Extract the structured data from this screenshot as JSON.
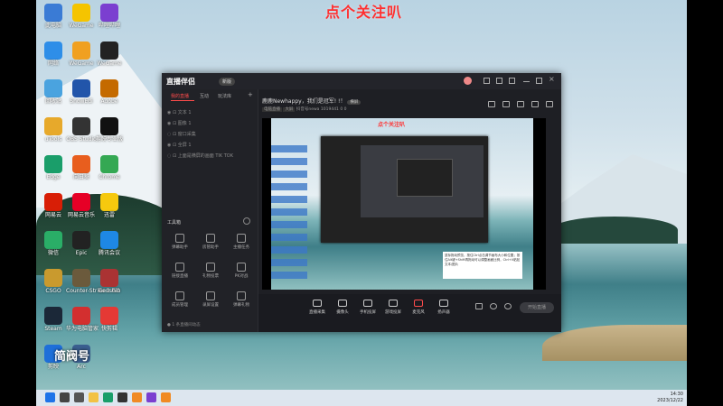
{
  "overlay_title": "点个关注叭",
  "watermark": "简阀号",
  "desktop_icons": [
    {
      "label": "此电脑",
      "color": "#3a7bd5",
      "col": 0,
      "row": 0
    },
    {
      "label": "WeGame",
      "color": "#f5c400",
      "col": 1,
      "row": 0
    },
    {
      "label": "哔哩哔哩",
      "color": "#7b3fd0",
      "col": 2,
      "row": 0
    },
    {
      "label": "网络",
      "color": "#2e8ee8",
      "col": 0,
      "row": 1
    },
    {
      "label": "WeGame",
      "color": "#f0a020",
      "col": 1,
      "row": 1
    },
    {
      "label": "WeGame",
      "color": "#222",
      "col": 2,
      "row": 1
    },
    {
      "label": "回收站",
      "color": "#4aa3df",
      "col": 0,
      "row": 2
    },
    {
      "label": "SnowEdi",
      "color": "#2255aa",
      "col": 1,
      "row": 2
    },
    {
      "label": "Adobe",
      "color": "#c46a00",
      "col": 2,
      "row": 2
    },
    {
      "label": "uTools",
      "color": "#e7a92b",
      "col": 0,
      "row": 3
    },
    {
      "label": "OBS Studio",
      "color": "#333",
      "col": 1,
      "row": 3
    },
    {
      "label": "剪映专业版",
      "color": "#111",
      "col": 2,
      "row": 3
    },
    {
      "label": "Edge",
      "color": "#1a9e6a",
      "col": 0,
      "row": 4
    },
    {
      "label": "向日葵",
      "color": "#e85e1e",
      "col": 1,
      "row": 4
    },
    {
      "label": "Chrome",
      "color": "#34a853",
      "col": 2,
      "row": 4
    },
    {
      "label": "网易云",
      "color": "#d81e06",
      "col": 0,
      "row": 5
    },
    {
      "label": "网易云音乐",
      "color": "#e60026",
      "col": 1,
      "row": 5
    },
    {
      "label": "迅雷",
      "color": "#f6c90e",
      "col": 2,
      "row": 5
    },
    {
      "label": "微信",
      "color": "#2aae67",
      "col": 0,
      "row": 6
    },
    {
      "label": "Epic",
      "color": "#222",
      "col": 1,
      "row": 6
    },
    {
      "label": "腾讯会议",
      "color": "#1e88e5",
      "col": 2,
      "row": 6
    },
    {
      "label": "CSGO",
      "color": "#c99a2e",
      "col": 0,
      "row": 7
    },
    {
      "label": "Counter-Strike 2 GO",
      "color": "#6b5a3c",
      "col": 1,
      "row": 7
    },
    {
      "label": "Genshin",
      "color": "#a33",
      "col": 2,
      "row": 7
    },
    {
      "label": "Steam",
      "color": "#1b2838",
      "col": 0,
      "row": 8
    },
    {
      "label": "华为电脑管家",
      "color": "#d32f2f",
      "col": 1,
      "row": 8
    },
    {
      "label": "快剪辑",
      "color": "#e53935",
      "col": 2,
      "row": 8
    },
    {
      "label": "剪映",
      "color": "#1e6fd9",
      "col": 0,
      "row": 9
    },
    {
      "label": "Arc",
      "color": "#3a5f8f",
      "col": 1,
      "row": 9
    }
  ],
  "taskbar_icons": [
    {
      "name": "start-icon",
      "color": "#1e73e8"
    },
    {
      "name": "search-icon",
      "color": "#444"
    },
    {
      "name": "task-view-icon",
      "color": "#555"
    },
    {
      "name": "file-explorer-icon",
      "color": "#f2c244"
    },
    {
      "name": "edge-icon",
      "color": "#1a9e6a"
    },
    {
      "name": "obs-icon",
      "color": "#333"
    },
    {
      "name": "app-icon",
      "color": "#f08a24"
    },
    {
      "name": "app2-icon",
      "color": "#7b3fd0"
    },
    {
      "name": "live-icon",
      "color": "#f08a24"
    }
  ],
  "clock": {
    "time": "14:30",
    "date": "2023/12/22"
  },
  "app": {
    "logo": "直播伴侣",
    "version": "新版",
    "tabs": [
      "我的直播",
      "互动",
      "玩法库"
    ],
    "add": "+",
    "scene_items": [
      "文本 1",
      "图像 1",
      "窗口采集",
      "全屏 1",
      "上面是横屏的画面 TIK TOK"
    ],
    "tools_header": "工具箱",
    "tools": [
      "弹幕助手",
      "房管助手",
      "主播任务",
      "链接直播",
      "礼物投票",
      "PK对战",
      "成员管理",
      "录屏设置",
      "弹幕礼物"
    ],
    "bottom_note": "1 条直播间动态",
    "room_title": "鹿鹿Newhappy，我们是冠军! !！",
    "room_tag": "横屏",
    "room_info": [
      "电脑直播",
      "大屏",
      "抖音号newa",
      "1019441",
      "0",
      "0"
    ],
    "bottom_btns": [
      "直播采集",
      "摄像头",
      "手机投屏",
      "游戏投屏",
      "麦克风",
      "扬声器"
    ],
    "start_label": "开始直播",
    "tip": "鼠标拖动预览，按住Ctrl点击调节画布大小和位置；按住Alt键+Shift再拖动可以调整画面比例，Ctrl+V粘贴文本/图片"
  }
}
